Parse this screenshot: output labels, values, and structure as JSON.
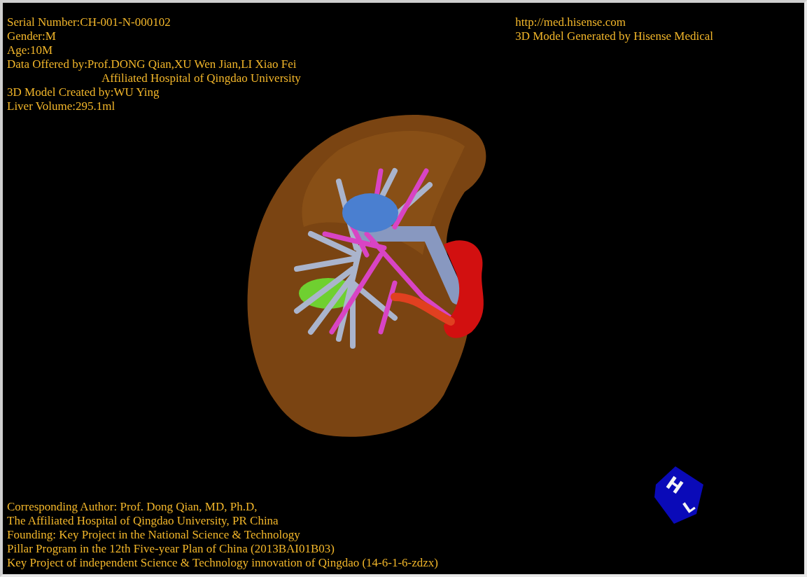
{
  "info_left": [
    {
      "text": "Serial Number:CH-001-N-000102",
      "kind": "line"
    },
    {
      "text": "Gender:M",
      "kind": "line"
    },
    {
      "text": "Age:10M",
      "kind": "line"
    },
    {
      "text": "Data Offered by:Prof.DONG Qian,XU Wen Jian,LI Xiao Fei",
      "kind": "line"
    },
    {
      "text": "Affiliated Hospital of Qingdao University",
      "kind": "indented"
    },
    {
      "text": "3D Model Created by:WU Ying",
      "kind": "line"
    },
    {
      "text": "Liver Volume:295.1ml",
      "kind": "line"
    }
  ],
  "info_right": [
    "http://med.hisense.com",
    "3D Model Generated by Hisense Medical"
  ],
  "credits": [
    "Corresponding Author: Prof. Dong Qian, MD, Ph.D,",
    "The Affiliated Hospital of Qingdao University, PR China",
    "Founding: Key Project in the National Science & Technology",
    "Pillar Program in the 12th Five-year Plan of China (2013BAI01B03)",
    "Key Project of independent Science & Technology innovation of Qingdao (14-6-1-6-zdzx)"
  ],
  "orientation_cube": {
    "labels": [
      "H",
      "L"
    ]
  }
}
